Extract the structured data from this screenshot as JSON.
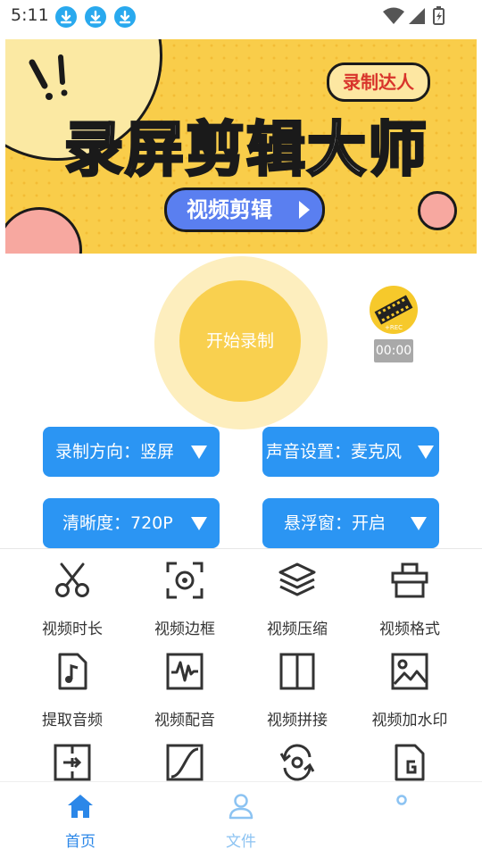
{
  "status_bar": {
    "time": "5:11",
    "notification_icons": [
      "download-icon",
      "download-icon",
      "download-icon"
    ],
    "system_icons": [
      "wifi-icon",
      "signal-icon",
      "battery-charging-icon"
    ]
  },
  "banner": {
    "tag": "录制达人",
    "title": "录屏剪辑大师",
    "button_label": "视频剪辑",
    "colors": {
      "background": "#f9cd4a",
      "pill": "#5a7ff0",
      "tag_text": "#d8342b"
    }
  },
  "record": {
    "start_label": "开始录制",
    "timer": "00:00",
    "logo_text": "+REC",
    "colors": {
      "outer": "#fdeebe",
      "inner": "#f9d04f"
    }
  },
  "settings": {
    "direction": "录制方向：竖屏",
    "audio": "声音设置：麦克风",
    "quality": "清晰度：720P",
    "floating": "悬浮窗：开启",
    "accent": "#2b95f3"
  },
  "tools": [
    {
      "label": "视频时长",
      "icon": "scissors-icon"
    },
    {
      "label": "视频边框",
      "icon": "frame-icon"
    },
    {
      "label": "视频压缩",
      "icon": "layers-icon"
    },
    {
      "label": "视频格式",
      "icon": "format-icon"
    },
    {
      "label": "提取音频",
      "icon": "music-file-icon"
    },
    {
      "label": "视频配音",
      "icon": "waveform-icon"
    },
    {
      "label": "视频拼接",
      "icon": "split-icon"
    },
    {
      "label": "视频加水印",
      "icon": "image-icon"
    },
    {
      "label": "",
      "icon": "transfer-icon"
    },
    {
      "label": "",
      "icon": "curve-icon"
    },
    {
      "label": "",
      "icon": "rotate-icon"
    },
    {
      "label": "",
      "icon": "gif-file-icon"
    }
  ],
  "nav": {
    "home": "首页",
    "files": "文件",
    "third": "",
    "active_color": "#2b87e8",
    "inactive_color": "#8cc3f2"
  }
}
